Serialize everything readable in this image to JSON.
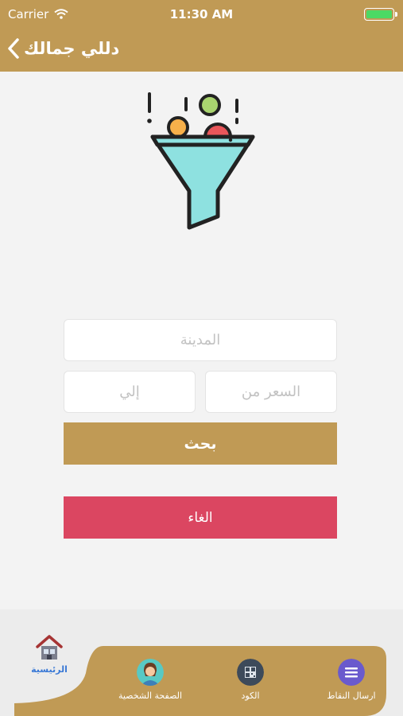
{
  "status_bar": {
    "carrier": "Carrier",
    "time": "11:30 AM"
  },
  "nav": {
    "title": "دللي جمالك"
  },
  "form": {
    "city_placeholder": "المدينة",
    "price_from_placeholder": "السعر من",
    "price_to_placeholder": "إلي",
    "search_label": "بحث",
    "cancel_label": "الغاء"
  },
  "tabbar": {
    "items": [
      {
        "label": "الرئيسية",
        "icon": "home-icon",
        "active": true
      },
      {
        "label": "الصفحة الشخصية",
        "icon": "profile-avatar-icon"
      },
      {
        "label": "الكود",
        "icon": "qr-code-icon"
      },
      {
        "label": "ارسال النقاط",
        "icon": "menu-lines-icon"
      }
    ]
  },
  "colors": {
    "brand_gold": "#c09a55",
    "cancel_red": "#db4661",
    "active_tab_blue": "#3a79d6",
    "background": "#f3f3f3"
  }
}
